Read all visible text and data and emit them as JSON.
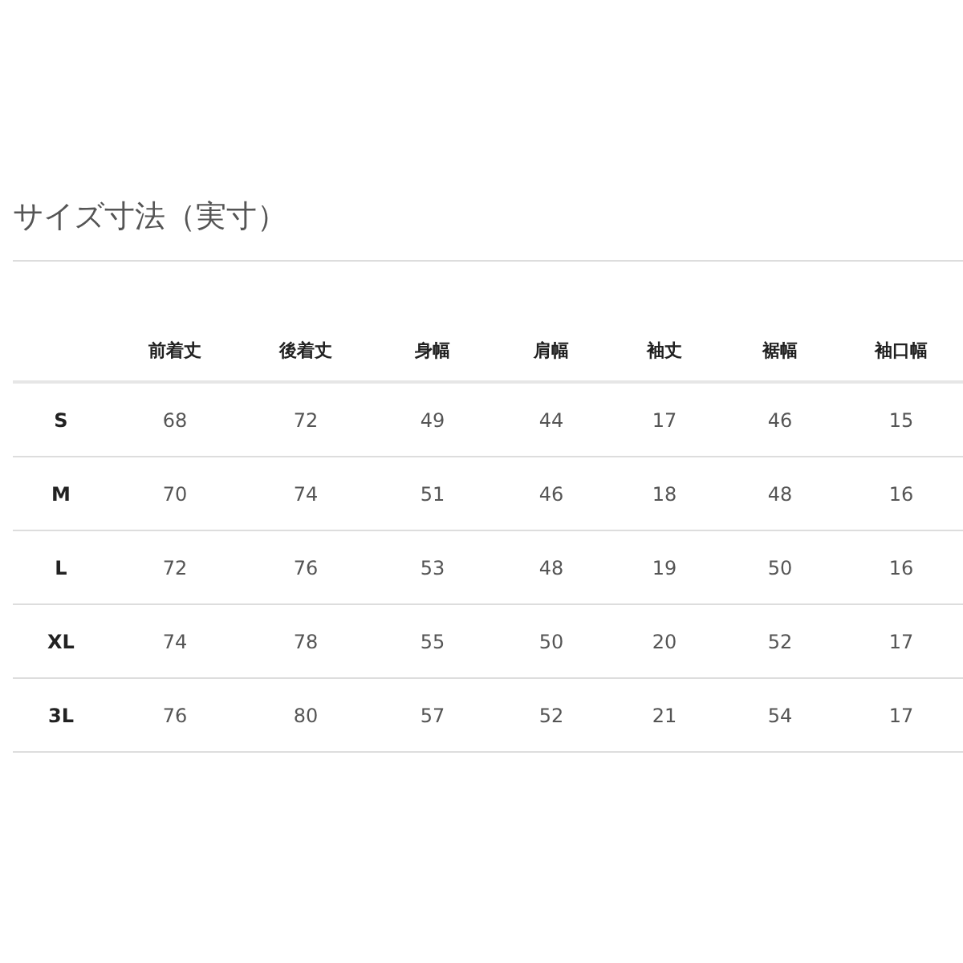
{
  "title": "サイズ寸法（実寸）",
  "table": {
    "columns": [
      "",
      "前着丈",
      "後着丈",
      "身幅",
      "肩幅",
      "袖丈",
      "裾幅",
      "袖口幅"
    ],
    "rows": [
      [
        "S",
        "68",
        "72",
        "49",
        "44",
        "17",
        "46",
        "15"
      ],
      [
        "M",
        "70",
        "74",
        "51",
        "46",
        "18",
        "48",
        "16"
      ],
      [
        "L",
        "72",
        "76",
        "53",
        "48",
        "19",
        "50",
        "16"
      ],
      [
        "XL",
        "74",
        "78",
        "55",
        "50",
        "20",
        "52",
        "17"
      ],
      [
        "3L",
        "76",
        "80",
        "57",
        "52",
        "21",
        "54",
        "17"
      ]
    ]
  }
}
